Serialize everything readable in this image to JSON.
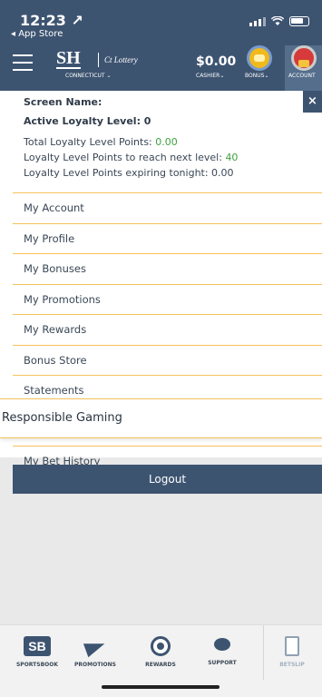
{
  "status": {
    "time": "12:23 ↗",
    "back_label": "◂ App Store"
  },
  "header": {
    "logo_sh": "SH",
    "logo_ct": "Ct Lottery",
    "state": "CONNECTICUT ⌄",
    "balance": "$0.00",
    "cashier": "CASHIER⌄",
    "bonus": "BONUS⌄",
    "account": "ACCOUNT"
  },
  "panel": {
    "screen_name_label": "Screen Name:",
    "loyalty_level": "Active Loyalty Level: 0",
    "total_points_label": "Total Loyalty Level Points: ",
    "total_points_value": "0.00",
    "next_level_label": "Loyalty Level Points to reach next level: ",
    "next_level_value": "40",
    "expiring_label": "Loyalty Level Points expiring tonight: 0.00",
    "close": "×"
  },
  "menu": {
    "items": [
      "My Account",
      "My Profile",
      "My Bonuses",
      "My Promotions",
      "My Rewards",
      "Bonus Store",
      "Statements"
    ],
    "responsible": "Responsible Gaming",
    "bet_history": "My Bet History",
    "logout": "Logout"
  },
  "bottom_nav": {
    "sportsbook": "SPORTSBOOK",
    "sportsbook_logo": "SB",
    "promotions": "PROMOTIONS",
    "rewards": "REWARDS",
    "support": "SUPPORT",
    "betslip": "BETSLIP"
  },
  "colors": {
    "brand": "#3d5471",
    "accent_line": "#f4c25c",
    "positive": "#3f9f3f"
  }
}
